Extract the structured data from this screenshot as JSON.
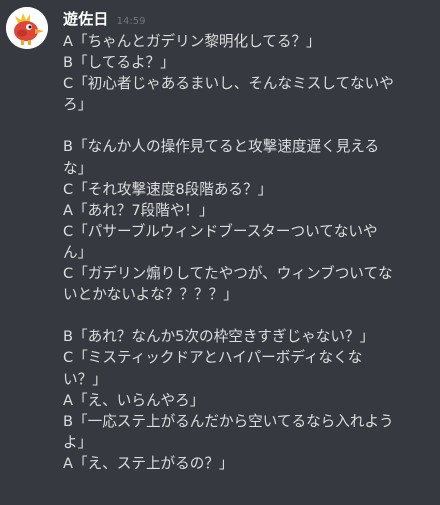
{
  "message": {
    "username": "遊佐日",
    "timestamp": "14:59",
    "avatar_icon": "red-bird-character-icon",
    "lines": [
      "A「ちゃんとガデリン黎明化してる？」",
      "B「してるよ？」",
      "C「初心者じゃあるまいし、そんなミスしてないや",
      "ろ」",
      "",
      "B「なんか人の操作見てると攻撃速度遅く見える",
      "な」",
      "C「それ攻撃速度8段階ある？」",
      "A「あれ？7段階や！」",
      "C「パサーブルウィンドブースターついてないや",
      "ん」",
      "C「ガデリン煽りしてたやつが、ウィンブついてな",
      "いとかないよな？？？？」",
      "",
      "B「あれ？なんか5次の枠空きすぎじゃない？」",
      " C「ミスティックドアとハイパーボディなくな",
      "い？」",
      "A「え、いらんやろ」",
      "B「一応ステ上がるんだから空いてるなら入れよう",
      "よ」",
      "A「え、ステ上がるの？」"
    ]
  },
  "colors": {
    "background": "#36393f",
    "username": "#ffffff",
    "text": "#dcddde",
    "timestamp": "#72767d"
  }
}
